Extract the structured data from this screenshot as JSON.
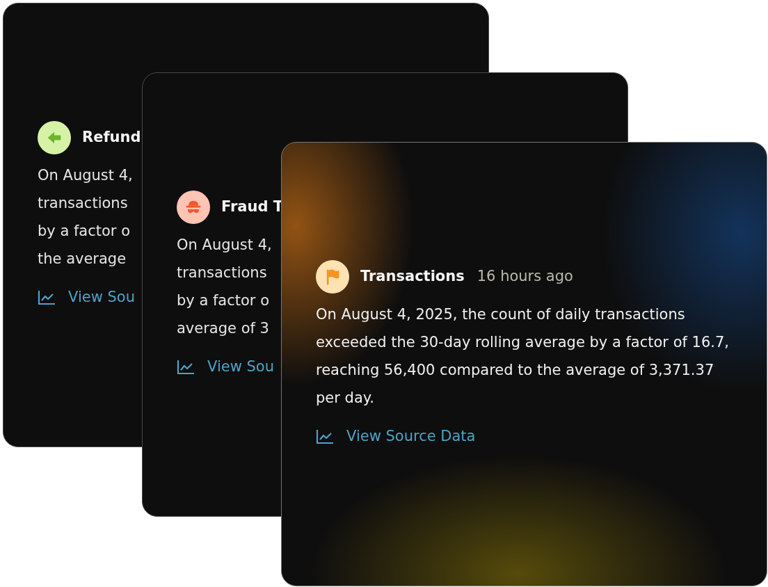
{
  "cards": [
    {
      "kind": "refund",
      "color": "#d6f2a6",
      "title": "Refund",
      "lines": [
        "On August 4,",
        "transactions",
        "by a factor o",
        "the average"
      ],
      "link": "View Sou"
    },
    {
      "kind": "fraud",
      "color": "#ffc4b4",
      "title": "Fraud T",
      "lines": [
        "On August 4,",
        "transactions",
        "by a factor o",
        "average of 3"
      ],
      "link": "View Sou"
    },
    {
      "kind": "alert",
      "color": "#ffe2b4",
      "title": "Transactions",
      "time": "16 hours ago",
      "body": "On August 4, 2025, the count of daily transactions exceeded the 30-day rolling average by a factor of 16.7, reaching 56,400 compared to the average of 3,371.37 per day.",
      "link": "View Source Data"
    }
  ]
}
